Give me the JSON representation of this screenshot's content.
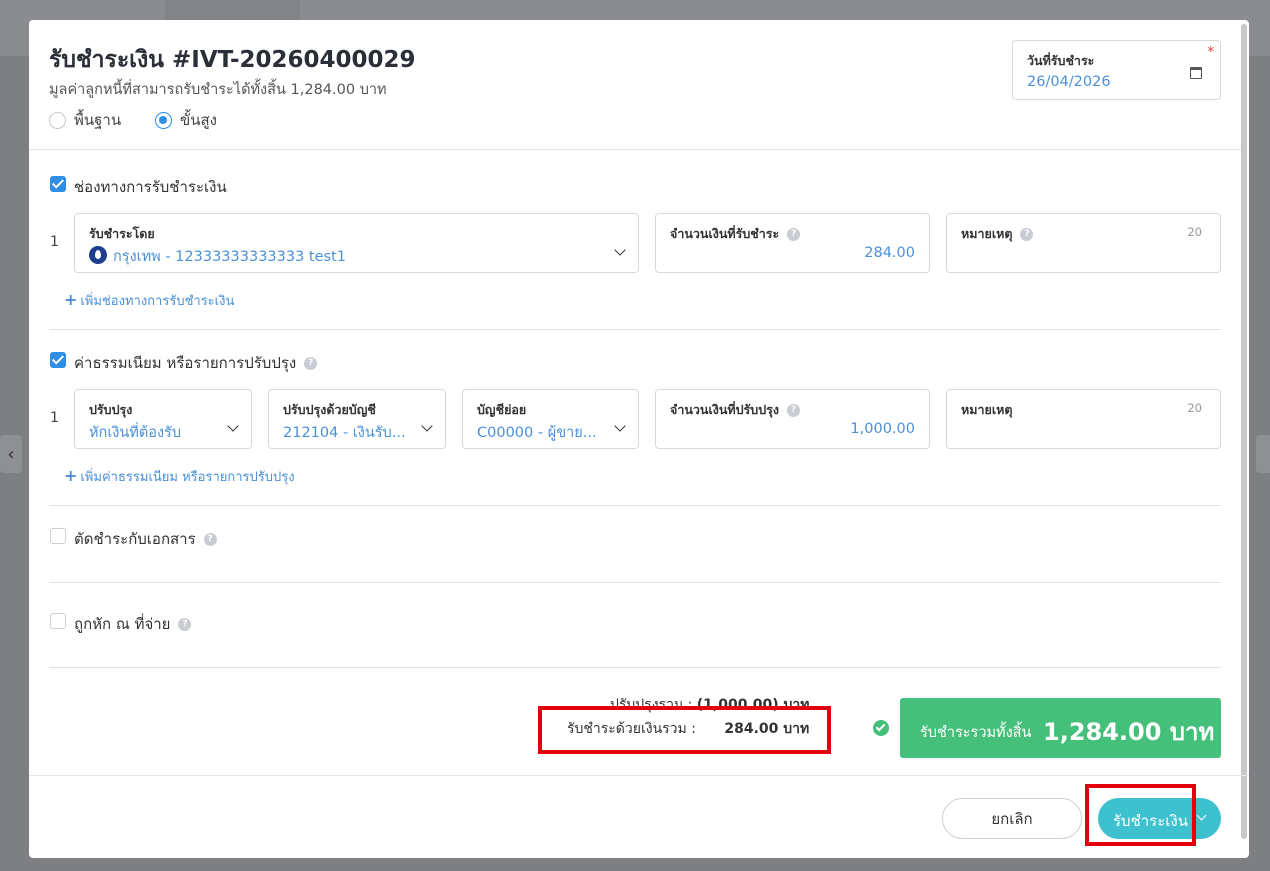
{
  "modal": {
    "title": "รับชำระเงิน #IVT-20260400029",
    "subtitle": "มูลค่าลูกหนี้ที่สามารถรับชำระได้ทั้งสิ้น 1,284.00 บาท",
    "mode_basic": "พื้นฐาน",
    "mode_advanced": "ขั้นสูง",
    "selected_mode": "ขั้นสูง"
  },
  "date": {
    "label": "วันที่รับชำระ",
    "required_mark": "*",
    "value": "26/04/2026"
  },
  "payment_channel": {
    "section_label": "ช่องทางการรับชำระเงิน",
    "checked": true,
    "row_number": "1",
    "method_label": "รับชำระโดย",
    "method_value": "กรุงเทพ - 12333333333333 test1",
    "amount_label": "จำนวนเงินที่รับชำระ",
    "amount_value": "284.00",
    "note_label": "หมายเหตุ",
    "note_count": "20",
    "add_link": "เพิ่มช่องทางการรับชำระเงิน"
  },
  "adjustment": {
    "section_label": "ค่าธรรมเนียม หรือรายการปรับปรุง",
    "checked": true,
    "row_number": "1",
    "adjust_label": "ปรับปรุง",
    "adjust_value": "หักเงินที่ต้องรับ",
    "account_label": "ปรับปรุงด้วยบัญชี",
    "account_value": "212104 - เงินรับ...",
    "sub_account_label": "บัญชีย่อย",
    "sub_account_value": "C00000 - ผู้ขาย...",
    "amount_label": "จำนวนเงินที่ปรับปรุง",
    "amount_value": "1,000.00",
    "note_label": "หมายเหตุ",
    "note_count": "20",
    "add_link": "เพิ่มค่าธรรมเนียม หรือรายการปรับปรุง"
  },
  "offset_documents": {
    "section_label": "ตัดชำระกับเอกสาร",
    "checked": false
  },
  "withholding": {
    "section_label": "ถูกหัก ณ ที่จ่าย",
    "checked": false
  },
  "summary": {
    "adjust_total_label": "ปรับปรุงรวม :",
    "adjust_total_value": "(1,000.00) บาท",
    "cash_total_label": "รับชำระด้วยเงินรวม :",
    "cash_total_value": "284.00 บาท",
    "grand_total_label": "รับชำระรวมทั้งสิ้น",
    "grand_total_value": "1,284.00 บาท"
  },
  "footer": {
    "cancel_label": "ยกเลิก",
    "submit_label": "รับชำระเงิน"
  },
  "colors": {
    "accent_blue": "#2f8ee5",
    "total_green": "#45c07a",
    "submit_teal": "#3ec1cf",
    "highlight_red": "#e5000f"
  }
}
